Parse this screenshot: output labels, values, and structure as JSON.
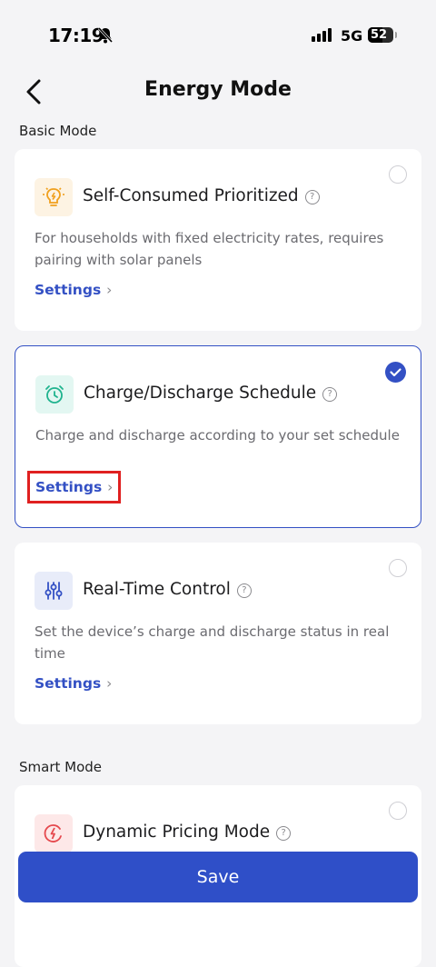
{
  "status_bar": {
    "time": "17:19",
    "network": "5G",
    "battery": "52"
  },
  "header": {
    "title": "Energy Mode"
  },
  "sections": {
    "basic": "Basic Mode",
    "smart": "Smart Mode"
  },
  "modes": [
    {
      "title": "Self-Consumed Prioritized",
      "description": "For households with fixed electricity rates, requires pairing with solar panels",
      "settings_label": "Settings",
      "selected": false,
      "icon": "lightbulb-icon"
    },
    {
      "title": "Charge/Discharge Schedule",
      "description": "Charge and discharge according to your set schedule",
      "settings_label": "Settings",
      "selected": true,
      "icon": "alarm-clock-icon"
    },
    {
      "title": "Real-Time Control",
      "description": "Set the device’s charge and discharge status in real time",
      "settings_label": "Settings",
      "selected": false,
      "icon": "sliders-icon"
    },
    {
      "title": "Dynamic Pricing Mode",
      "selected": false,
      "icon": "pricing-bolt-icon"
    }
  ],
  "footer": {
    "save_label": "Save"
  },
  "colors": {
    "accent": "#2f4fc8",
    "highlight": "#e02020"
  }
}
